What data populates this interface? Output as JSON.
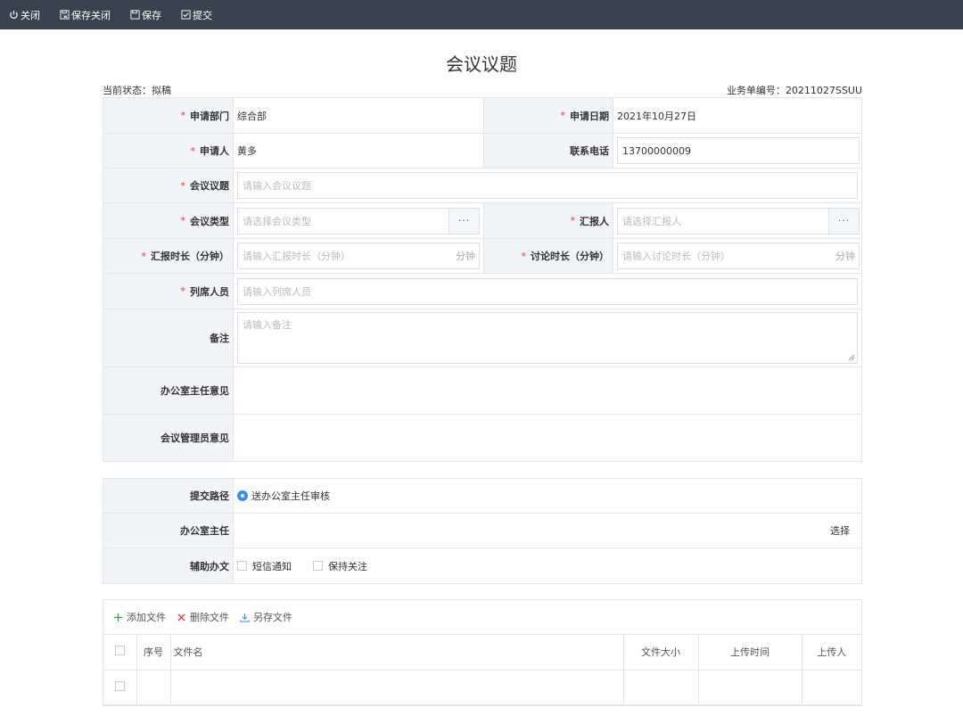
{
  "toolbar": {
    "close": "关闭",
    "save_close": "保存关闭",
    "save": "保存",
    "submit": "提交"
  },
  "title": "会议议题",
  "status": {
    "label": "当前状态：",
    "value": "拟稿"
  },
  "business_no": {
    "label": "业务单编号：",
    "value": "20211027SSUU"
  },
  "form": {
    "dept_label": "申请部门",
    "dept_value": "综合部",
    "date_label": "申请日期",
    "date_value": "2021年10月27日",
    "applicant_label": "申请人",
    "applicant_value": "黄多",
    "phone_label": "联系电话",
    "phone_value": "13700000009",
    "topic_label": "会议议题",
    "topic_placeholder": "请输入会议议题",
    "type_label": "会议类型",
    "type_placeholder": "请选择会议类型",
    "reporter_label": "汇报人",
    "reporter_placeholder": "请选择汇报人",
    "report_dur_label": "汇报时长（分钟）",
    "report_dur_placeholder": "请输入汇报时长（分钟）",
    "disc_dur_label": "讨论时长（分钟）",
    "disc_dur_placeholder": "请输入讨论时长（分钟）",
    "unit": "分钟",
    "attendees_label": "列席人员",
    "attendees_placeholder": "请输入列席人员",
    "remark_label": "备注",
    "remark_placeholder": "请输入备注",
    "director_opinion_label": "办公室主任意见",
    "admin_opinion_label": "会议管理员意见",
    "dots": "···"
  },
  "submit_section": {
    "path_label": "提交路径",
    "path_option": "送办公室主任审核",
    "director_label": "办公室主任",
    "choose": "选择",
    "assist_label": "辅助办文",
    "sms": "短信通知",
    "follow": "保持关注"
  },
  "files": {
    "add": "添加文件",
    "delete": "删除文件",
    "save_as": "另存文件",
    "columns": {
      "no": "序号",
      "name": "文件名",
      "size": "文件大小",
      "time": "上传时间",
      "uploader": "上传人"
    }
  },
  "colors": {
    "topbar": "#3a4250",
    "required": "#e03b3b",
    "radio": "#3a8ee6",
    "add_icon": "#2e9e4a",
    "delete_icon": "#d9362f",
    "save_as_icon": "#3a8ee6"
  }
}
